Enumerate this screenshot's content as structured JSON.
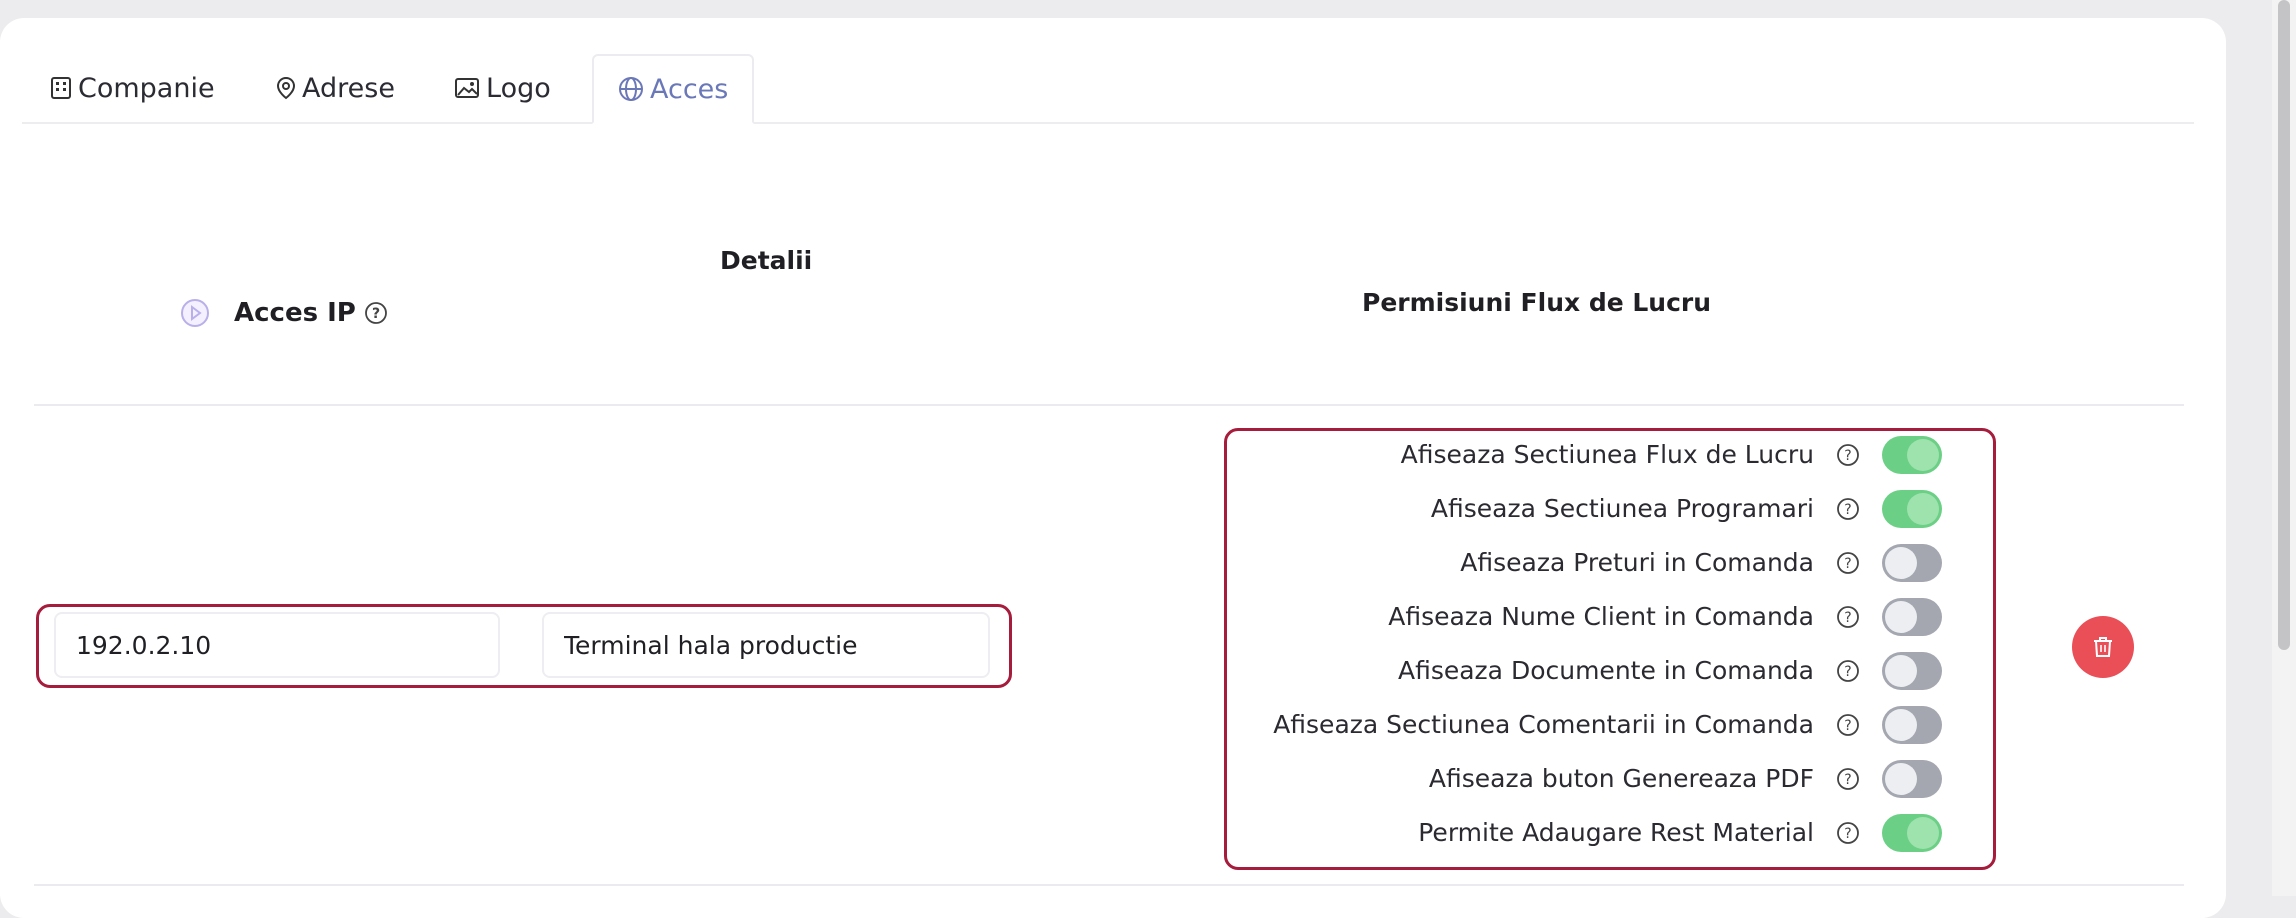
{
  "tabs": [
    {
      "label": "Companie",
      "icon": "building-icon"
    },
    {
      "label": "Adrese",
      "icon": "map-pin-icon"
    },
    {
      "label": "Logo",
      "icon": "image-icon"
    },
    {
      "label": "Acces",
      "icon": "globe-icon",
      "active": true
    }
  ],
  "header": {
    "detalii": "Detalii",
    "acces_ip": "Acces IP",
    "permisiuni": "Permisiuni Flux de Lucru"
  },
  "row": {
    "ip": "192.0.2.10",
    "description": "Terminal hala productie"
  },
  "permissions": [
    {
      "label": "Afiseaza Sectiunea Flux de Lucru",
      "enabled": true
    },
    {
      "label": "Afiseaza Sectiunea Programari",
      "enabled": true
    },
    {
      "label": "Afiseaza Preturi in Comanda",
      "enabled": false
    },
    {
      "label": "Afiseaza Nume Client in Comanda",
      "enabled": false
    },
    {
      "label": "Afiseaza Documente in Comanda",
      "enabled": false
    },
    {
      "label": "Afiseaza Sectiunea Comentarii in Comanda",
      "enabled": false
    },
    {
      "label": "Afiseaza buton Genereaza PDF",
      "enabled": false
    },
    {
      "label": "Permite Adaugare Rest Material",
      "enabled": true
    }
  ],
  "colors": {
    "active_tab": "#6b78b8",
    "toggle_on": "#6bd085",
    "toggle_off": "#a4a7b0",
    "delete": "#ea4e57",
    "highlight": "#a51c3c"
  }
}
